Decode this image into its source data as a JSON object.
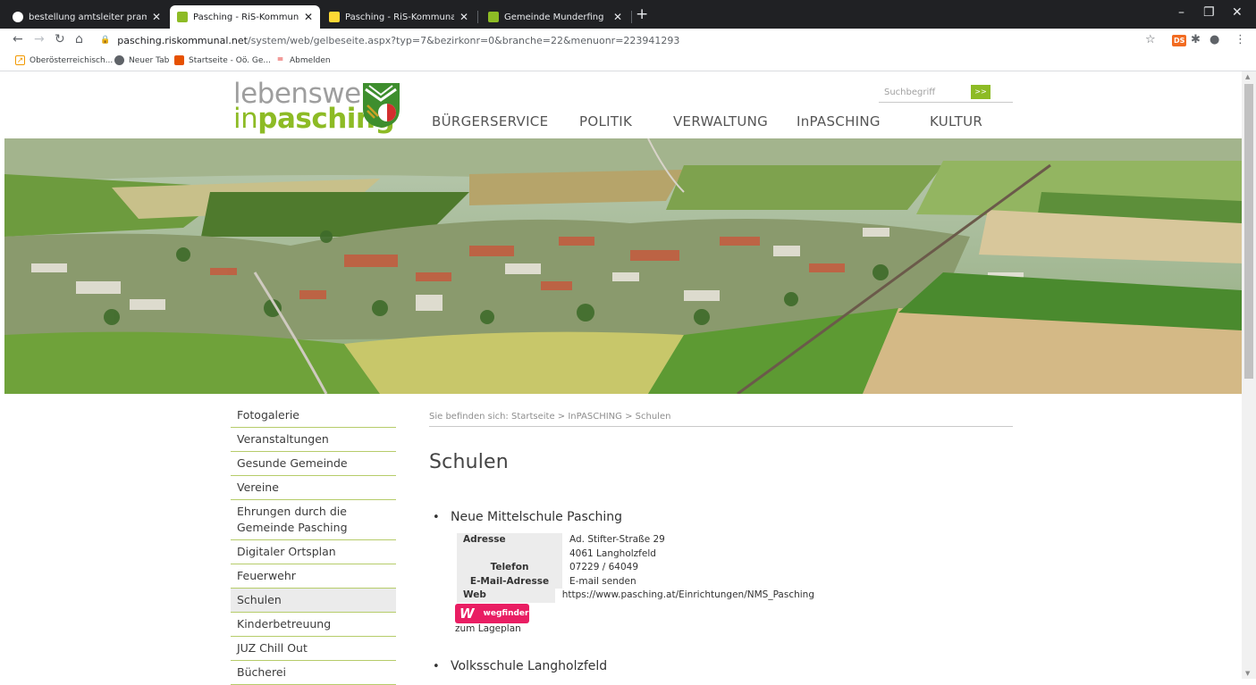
{
  "browser": {
    "tabs": [
      {
        "title": "bestellung amtsleiter pram – Goo",
        "favicon_color": "#4285f4",
        "active": false
      },
      {
        "title": "Pasching - RiS-Kommunal - Start",
        "favicon_color": "#8dbb25",
        "active": true
      },
      {
        "title": "Pasching - RiS-Kommunal - Start",
        "favicon_color": "#fdd835",
        "active": false
      },
      {
        "title": "Gemeinde Munderfing",
        "favicon_color": "#8dbb25",
        "active": false
      }
    ],
    "new_tab": "+",
    "url_host": "pasching.riskommunal.net",
    "url_path": "/system/web/gelbeseite.aspx?typ=7&bezirkonr=0&branche=22&menuonr=223941293",
    "bookmarks": [
      {
        "label": "Oberösterreichisch...",
        "icon": "doc-icon",
        "color": "#f29900"
      },
      {
        "label": "Neuer Tab",
        "icon": "globe-icon",
        "color": "#5f6368"
      },
      {
        "label": "Startseite - Oö. Ge...",
        "icon": "site-icon",
        "color": "#e65100"
      },
      {
        "label": "Abmelden",
        "icon": "logout-icon",
        "color": "#e53935"
      }
    ],
    "extension_badge": "DS"
  },
  "site": {
    "logo_line1": "lebenswert",
    "logo_line2_prefix": "in",
    "logo_line2_bold": "pasching",
    "nav": [
      "BÜRGERSERVICE",
      "POLITIK",
      "VERWALTUNG",
      "InPASCHING",
      "KULTUR"
    ],
    "search_placeholder": "Suchbegriff",
    "search_button": ">>",
    "accent_color": "#8dbb25"
  },
  "sidebar": {
    "items": [
      "Fotogalerie",
      "Veranstaltungen",
      "Gesunde Gemeinde",
      "Vereine",
      "Ehrungen durch die Gemeinde Pasching",
      "Digitaler Ortsplan",
      "Feuerwehr",
      "Schulen",
      "Kinderbetreuung",
      "JUZ Chill Out",
      "Bücherei"
    ],
    "active": "Schulen"
  },
  "content": {
    "breadcrumb": "Sie befinden sich: Startseite > InPASCHING > Schulen",
    "title": "Schulen",
    "schools": [
      {
        "name": "Neue Mittelschule Pasching",
        "details": [
          {
            "key": "Adresse",
            "value": "Ad. Stifter-Straße 29"
          },
          {
            "key": "",
            "value": "4061 Langholzfeld"
          },
          {
            "key": "Telefon",
            "value": "07229 / 64049"
          },
          {
            "key": "E-Mail-Adresse",
            "value": "E-mail senden"
          },
          {
            "key": "Web",
            "value": "https://www.pasching.at/Einrichtungen/NMS_Pasching"
          }
        ],
        "wegfinder_label": "wegfinder",
        "lageplan_label": "zum Lageplan"
      },
      {
        "name": "Volksschule Langholzfeld"
      }
    ]
  }
}
